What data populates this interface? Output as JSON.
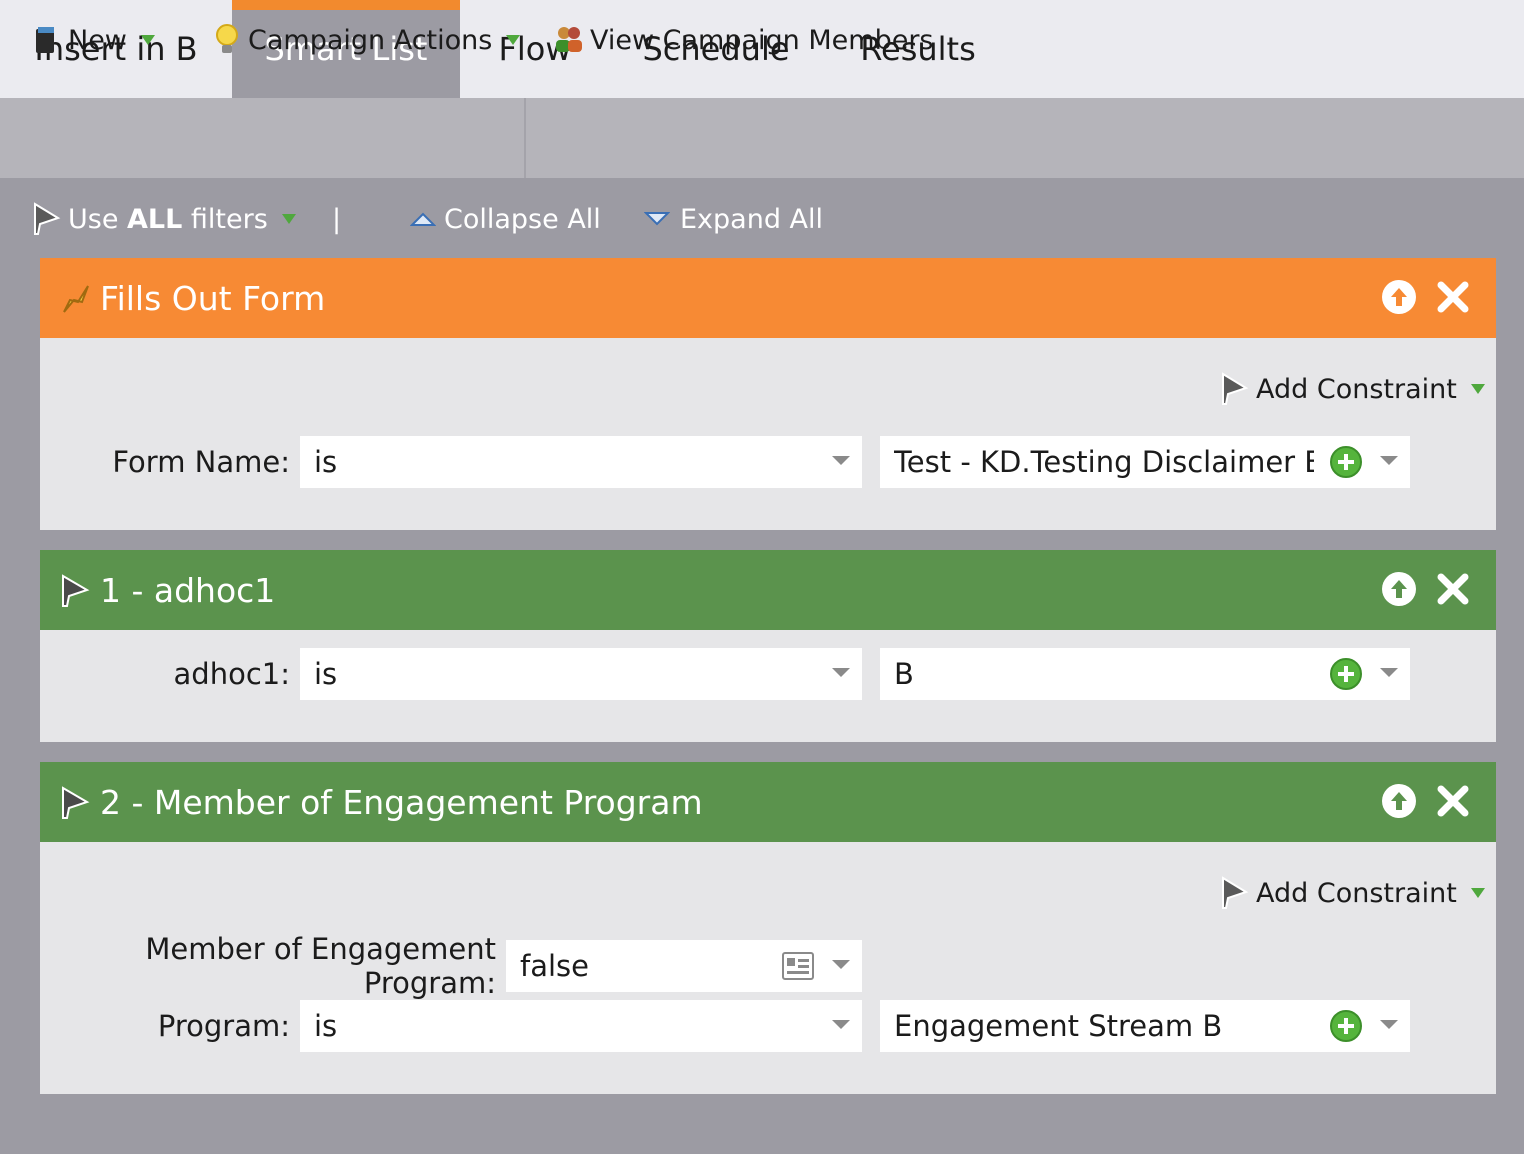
{
  "tabs": [
    {
      "label": "Insert in B",
      "active": false
    },
    {
      "label": "Smart List",
      "active": true
    },
    {
      "label": "Flow",
      "active": false
    },
    {
      "label": "Schedule",
      "active": false
    },
    {
      "label": "Results",
      "active": false
    }
  ],
  "toolbar": {
    "new_label": "New",
    "campaign_actions_label": "Campaign Actions",
    "view_members_label": "View Campaign Members"
  },
  "filter_bar": {
    "use_prefix": "Use ",
    "use_bold": "ALL",
    "use_suffix": " filters",
    "separator": "|",
    "collapse_label": "Collapse All",
    "expand_label": "Expand All"
  },
  "panels": {
    "trigger": {
      "title": "Fills Out Form",
      "add_constraint": "Add Constraint",
      "form_name_label": "Form Name:",
      "form_name_operator": "is",
      "form_name_value": "Test - KD.Testing Disclaimer Below"
    },
    "filter1": {
      "title": "1 - adhoc1",
      "field_label": "adhoc1:",
      "operator": "is",
      "value": "B"
    },
    "filter2": {
      "title": "2 - Member of Engagement Program",
      "add_constraint": "Add Constraint",
      "member_label": "Member of Engagement Program:",
      "member_value": "false",
      "program_label": "Program:",
      "program_operator": "is",
      "program_value": "Engagement Stream B"
    }
  },
  "colors": {
    "trigger_header": "#f78a34",
    "filter_header": "#5b934d",
    "active_tab_accent": "#f28a2e",
    "background": "#9c9ba3"
  }
}
